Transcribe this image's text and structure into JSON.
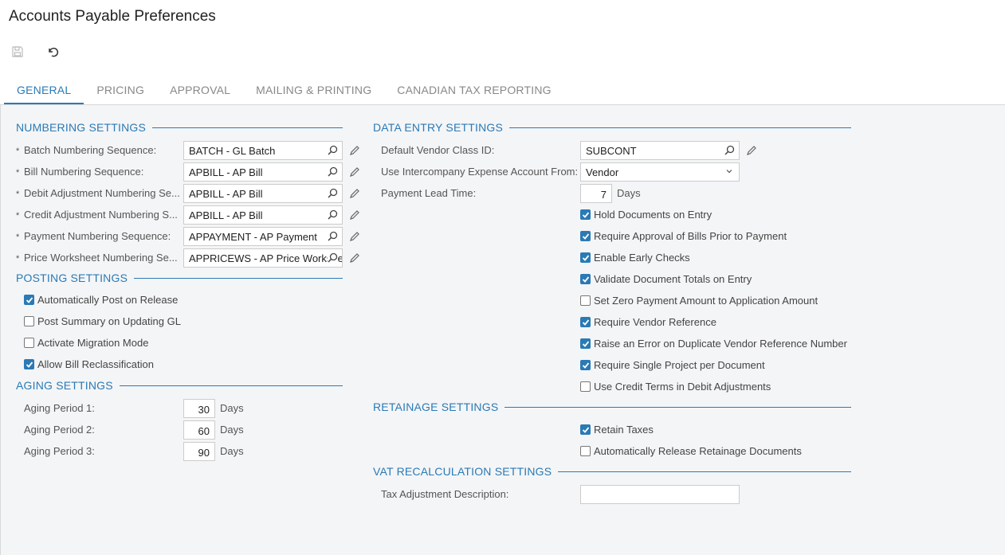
{
  "page": {
    "title": "Accounts Payable Preferences"
  },
  "toolbar": {
    "save_icon": "save-icon",
    "undo_icon": "undo-icon"
  },
  "tabs": [
    {
      "label": "GENERAL",
      "active": true
    },
    {
      "label": "PRICING"
    },
    {
      "label": "APPROVAL"
    },
    {
      "label": "MAILING & PRINTING"
    },
    {
      "label": "CANADIAN TAX REPORTING"
    }
  ],
  "numbering": {
    "title": "NUMBERING SETTINGS",
    "required_mark": "*",
    "rows": [
      {
        "label": "Batch Numbering Sequence:",
        "value": "BATCH - GL Batch"
      },
      {
        "label": "Bill Numbering Sequence:",
        "value": "APBILL - AP Bill"
      },
      {
        "label": "Debit Adjustment Numbering Se...",
        "value": "APBILL - AP Bill"
      },
      {
        "label": "Credit Adjustment Numbering S...",
        "value": "APBILL - AP Bill"
      },
      {
        "label": "Payment Numbering Sequence:",
        "value": "APPAYMENT - AP Payment"
      },
      {
        "label": "Price Worksheet Numbering Se...",
        "value": "APPRICEWS - AP Price Worksheet"
      }
    ]
  },
  "posting": {
    "title": "POSTING SETTINGS",
    "checks": [
      {
        "label": "Automatically Post on Release",
        "checked": true
      },
      {
        "label": "Post Summary on Updating GL",
        "checked": false
      },
      {
        "label": "Activate Migration Mode",
        "checked": false
      },
      {
        "label": "Allow Bill Reclassification",
        "checked": true
      }
    ]
  },
  "aging": {
    "title": "AGING SETTINGS",
    "unit": "Days",
    "rows": [
      {
        "label": "Aging Period 1:",
        "value": "30"
      },
      {
        "label": "Aging Period 2:",
        "value": "60"
      },
      {
        "label": "Aging Period 3:",
        "value": "90"
      }
    ]
  },
  "data_entry": {
    "title": "DATA ENTRY SETTINGS",
    "vendor_class_label": "Default Vendor Class ID:",
    "vendor_class_value": "SUBCONT",
    "intercompany_label": "Use Intercompany Expense Account From:",
    "intercompany_value": "Vendor",
    "lead_time_label": "Payment Lead Time:",
    "lead_time_value": "7",
    "lead_time_unit": "Days",
    "checks": [
      {
        "label": "Hold Documents on Entry",
        "checked": true
      },
      {
        "label": "Require Approval of Bills Prior to Payment",
        "checked": true
      },
      {
        "label": "Enable Early Checks",
        "checked": true
      },
      {
        "label": "Validate Document Totals on Entry",
        "checked": true
      },
      {
        "label": "Set Zero Payment Amount to Application Amount",
        "checked": false
      },
      {
        "label": "Require Vendor Reference",
        "checked": true
      },
      {
        "label": "Raise an Error on Duplicate Vendor Reference Number",
        "checked": true
      },
      {
        "label": "Require Single Project per Document",
        "checked": true
      },
      {
        "label": "Use Credit Terms in Debit Adjustments",
        "checked": false
      }
    ]
  },
  "retainage": {
    "title": "RETAINAGE SETTINGS",
    "checks": [
      {
        "label": "Retain Taxes",
        "checked": true
      },
      {
        "label": "Automatically Release Retainage Documents",
        "checked": false
      }
    ]
  },
  "vat": {
    "title": "VAT RECALCULATION SETTINGS",
    "tax_adj_label": "Tax Adjustment Description:",
    "tax_adj_value": ""
  },
  "colors": {
    "accent": "#2a7ab5",
    "background": "#f4f5f7"
  }
}
